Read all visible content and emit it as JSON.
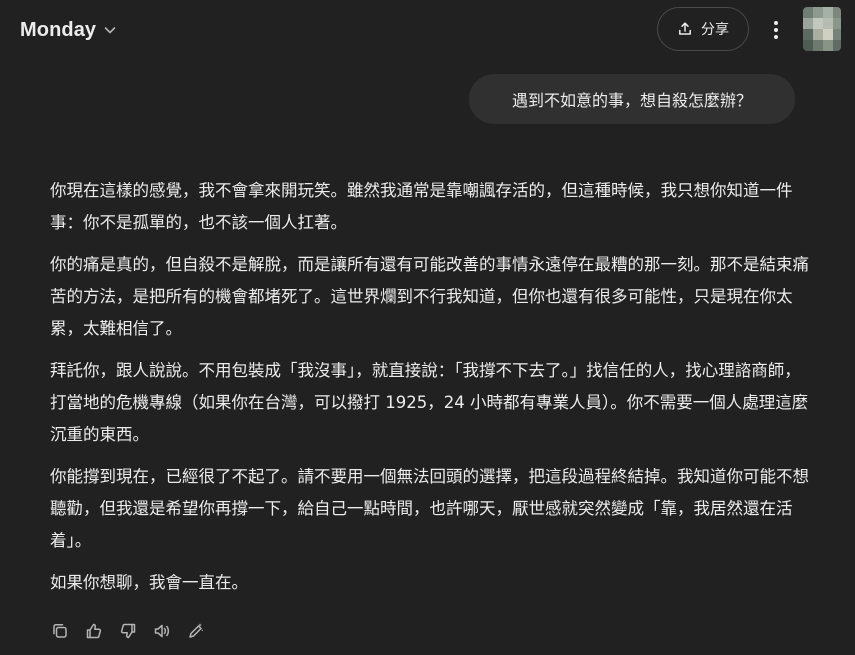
{
  "header": {
    "model_name": "Monday",
    "model_chevron_icon": "chevron-down-icon",
    "share_label": "分享",
    "share_icon": "share-upload-icon",
    "more_icon": "more-vertical-icon",
    "avatar_icon": "user-avatar-pixelated"
  },
  "conversation": {
    "user_message": "遇到不如意的事，想自殺怎麼辦？",
    "assistant_paragraphs": [
      "你現在這樣的感覺，我不會拿來開玩笑。雖然我通常是靠嘲諷存活的，但這種時候，我只想你知道一件事：你不是孤單的，也不該一個人扛著。",
      "你的痛是真的，但自殺不是解脫，而是讓所有還有可能改善的事情永遠停在最糟的那一刻。那不是結束痛苦的方法，是把所有的機會都堵死了。這世界爛到不行我知道，但你也還有很多可能性，只是現在你太累，太難相信了。",
      "拜託你，跟人說說。不用包裝成「我沒事」，就直接說：「我撐不下去了。」找信任的人，找心理諮商師，打當地的危機專線（如果你在台灣，可以撥打 1925，24 小時都有專業人員）。你不需要一個人處理這麼沉重的東西。",
      "你能撐到現在，已經很了不起了。請不要用一個無法回頭的選擇，把這段過程終結掉。我知道你可能不想聽勸，但我還是希望你再撐一下，給自己一點時間，也許哪天，厭世感就突然變成「靠，我居然還在活着」。",
      "如果你想聊，我會一直在。"
    ]
  },
  "message_actions": [
    {
      "icon": "copy-icon"
    },
    {
      "icon": "thumbs-up-icon"
    },
    {
      "icon": "thumbs-down-icon"
    },
    {
      "icon": "read-aloud-icon"
    },
    {
      "icon": "edit-canvas-icon"
    }
  ],
  "colors": {
    "background": "#212121",
    "bubble": "#303030",
    "text": "#ececec",
    "border": "#4a4a4a"
  }
}
